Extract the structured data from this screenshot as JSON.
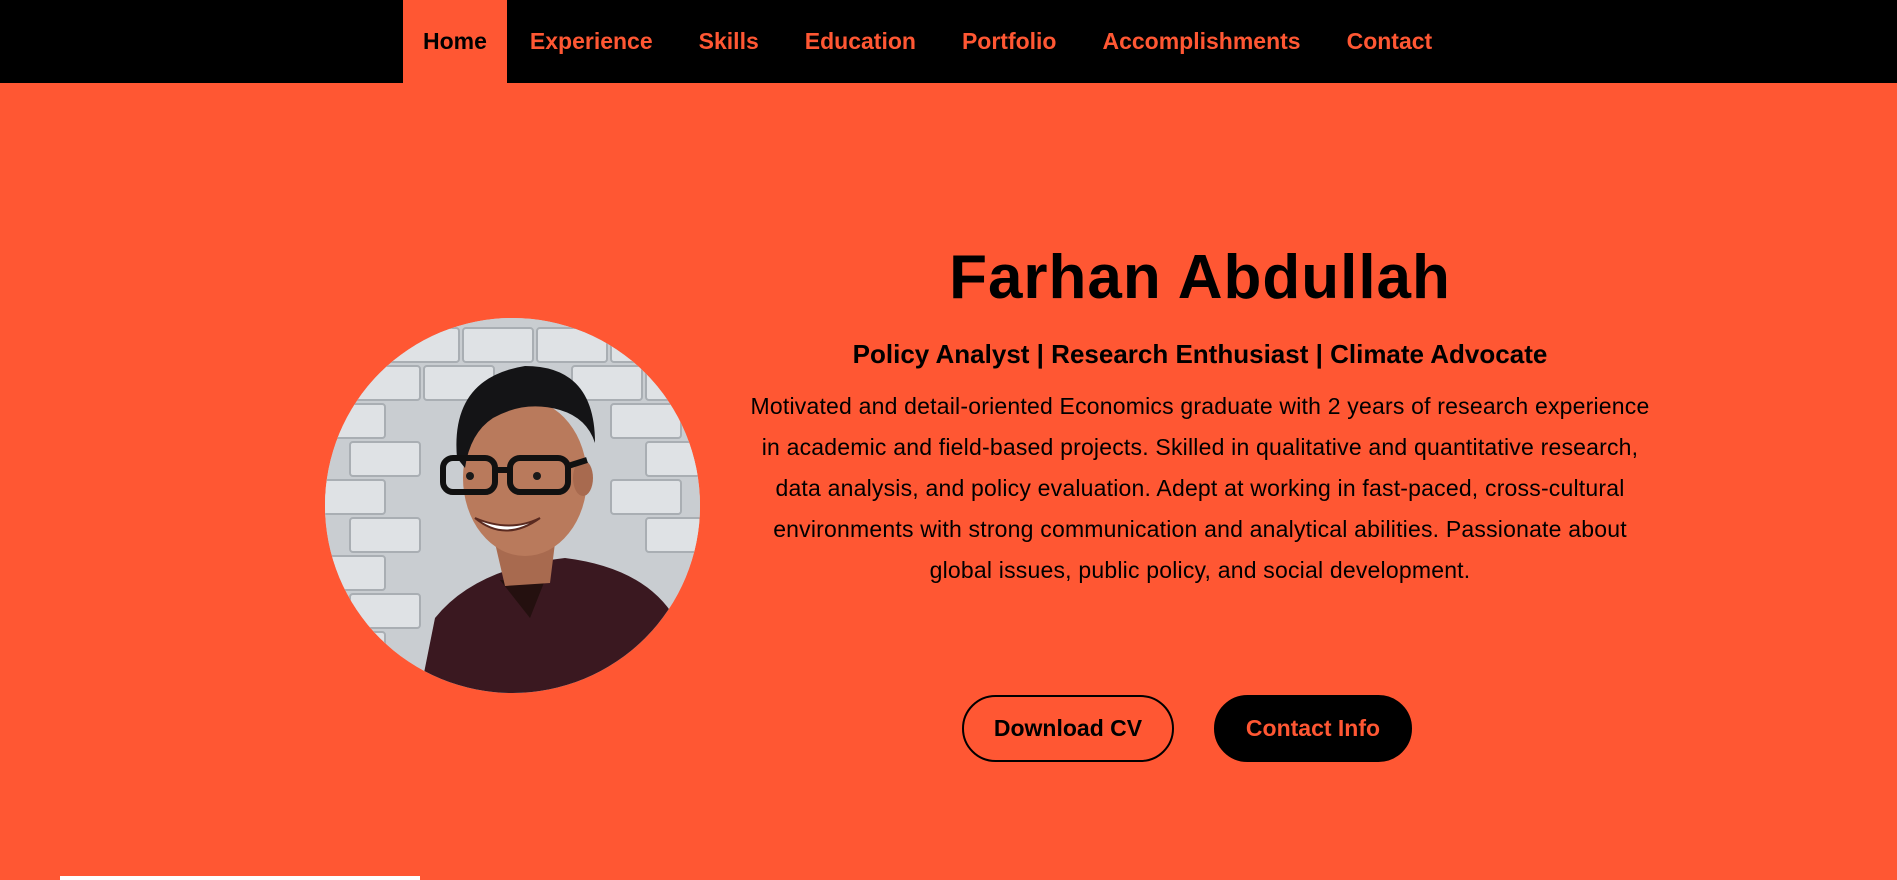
{
  "nav": {
    "items": [
      {
        "label": "Home",
        "active": true
      },
      {
        "label": "Experience",
        "active": false
      },
      {
        "label": "Skills",
        "active": false
      },
      {
        "label": "Education",
        "active": false
      },
      {
        "label": "Portfolio",
        "active": false
      },
      {
        "label": "Accomplishments",
        "active": false
      },
      {
        "label": "Contact",
        "active": false
      }
    ]
  },
  "hero": {
    "name": "Farhan Abdullah",
    "tagline": "Policy Analyst | Research Enthusiast | Climate Advocate",
    "bio": "Motivated and detail-oriented Economics graduate with 2 years of research experience in academic and field-based projects. Skilled in qualitative and quantitative research, data analysis, and policy evaluation. Adept at working in fast-paced, cross-cultural environments with strong communication and analytical abilities. Passionate about global issues, public policy, and social development.",
    "buttons": {
      "download_cv": "Download CV",
      "contact_info": "Contact Info"
    },
    "avatar_icon": "profile-photo"
  },
  "colors": {
    "accent": "#ff5733",
    "nav_bg": "#000000",
    "text": "#000000"
  }
}
